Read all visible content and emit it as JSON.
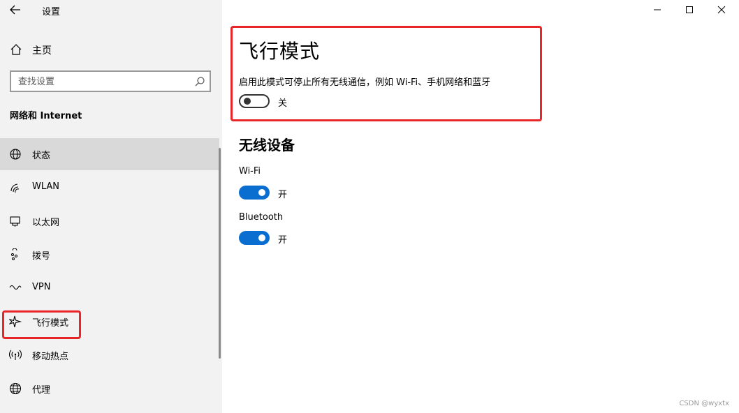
{
  "app": {
    "title": "设置"
  },
  "window_controls": {
    "minimize": "minimize-icon",
    "maximize": "maximize-icon",
    "close": "close-icon"
  },
  "sidebar": {
    "home": "主页",
    "search_placeholder": "查找设置",
    "section": "网络和 Internet",
    "items": [
      {
        "label": "状态",
        "icon": "globe-status-icon",
        "active": true
      },
      {
        "label": "WLAN",
        "icon": "wifi-icon",
        "active": false
      },
      {
        "label": "以太网",
        "icon": "ethernet-icon",
        "active": false
      },
      {
        "label": "拨号",
        "icon": "dialup-icon",
        "active": false
      },
      {
        "label": "VPN",
        "icon": "vpn-icon",
        "active": false
      },
      {
        "label": "飞行模式",
        "icon": "airplane-icon",
        "active": false
      },
      {
        "label": "移动热点",
        "icon": "hotspot-icon",
        "active": false
      },
      {
        "label": "代理",
        "icon": "globe-icon",
        "active": false
      }
    ]
  },
  "main": {
    "title": "飞行模式",
    "description": "启用此模式可停止所有无线通信，例如 Wi-Fi、手机网络和蓝牙",
    "airplane_toggle": {
      "state": "关",
      "on": false
    },
    "wireless_title": "无线设备",
    "devices": [
      {
        "name": "Wi-Fi",
        "state": "开",
        "on": true
      },
      {
        "name": "Bluetooth",
        "state": "开",
        "on": true
      }
    ]
  },
  "watermark": "CSDN @wyxtx",
  "colors": {
    "accent": "#0a6ed1",
    "highlight": "#e8262a",
    "sidebar_bg": "#f2f2f2"
  }
}
